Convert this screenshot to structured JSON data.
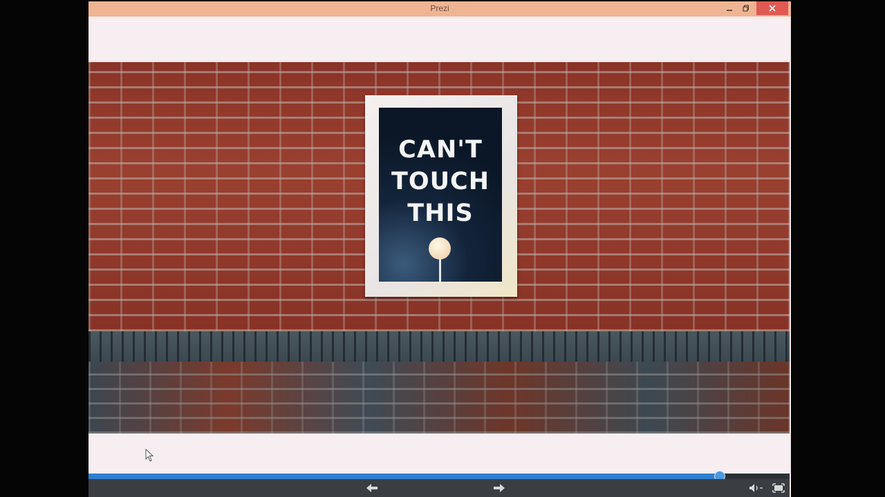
{
  "window": {
    "title": "Prezi"
  },
  "slide": {
    "poster_lines": [
      "CAN'T",
      "TOUCH",
      "THIS"
    ]
  },
  "player": {
    "progress": 0.9,
    "accent_color": "#2f7fd0"
  },
  "icons": {
    "minimize": "minimize-icon",
    "maximize": "maximize-icon",
    "close": "close-icon",
    "prev": "arrow-left-icon",
    "next": "arrow-right-icon",
    "volume": "volume-icon",
    "fullscreen": "fullscreen-icon",
    "cursor": "mouse-cursor-icon"
  }
}
